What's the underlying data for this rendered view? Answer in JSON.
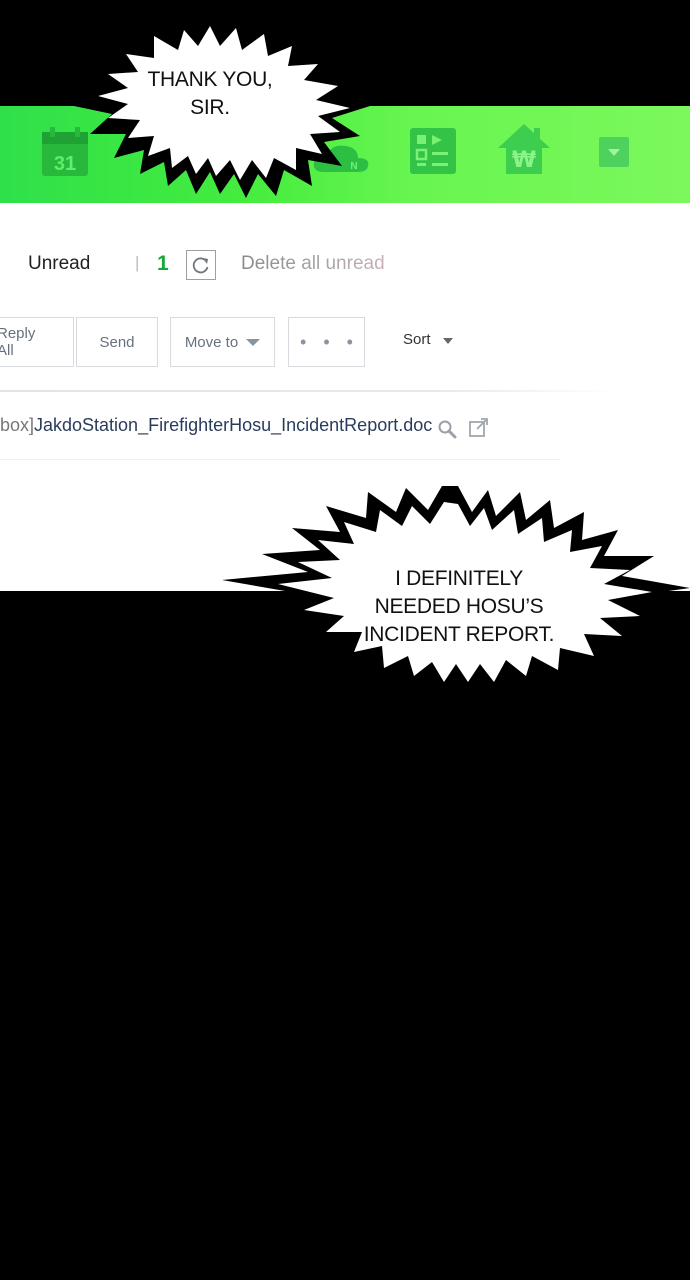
{
  "toolbar": {
    "icons": [
      {
        "name": "calendar-icon",
        "label": "31"
      },
      {
        "name": "contacts-icon"
      },
      {
        "name": "cloud-icon",
        "label": "N"
      },
      {
        "name": "survey-icon"
      },
      {
        "name": "home-payment-icon",
        "label": "₩"
      },
      {
        "name": "dropdown-icon"
      }
    ],
    "colors": {
      "start": "#2fe04a",
      "end": "#7cf85c"
    }
  },
  "mail": {
    "unread_label": "Unread",
    "separator": "|",
    "unread_count": "1",
    "delete_unread": "Delete all unread",
    "buttons": {
      "reply_all": "Reply All",
      "send": "Send",
      "move_to": "Move to",
      "more": "• • •"
    },
    "sort_label": "Sort",
    "attachment": {
      "prefix": "box]",
      "filename": "JakdoStation_FirefighterHosu_IncidentReport.doc"
    }
  },
  "bubbles": {
    "top": [
      "THANK YOU,",
      "SIR."
    ],
    "bottom": [
      "I DEFINITELY",
      "NEEDED HOSU’S",
      "INCIDENT REPORT."
    ]
  }
}
